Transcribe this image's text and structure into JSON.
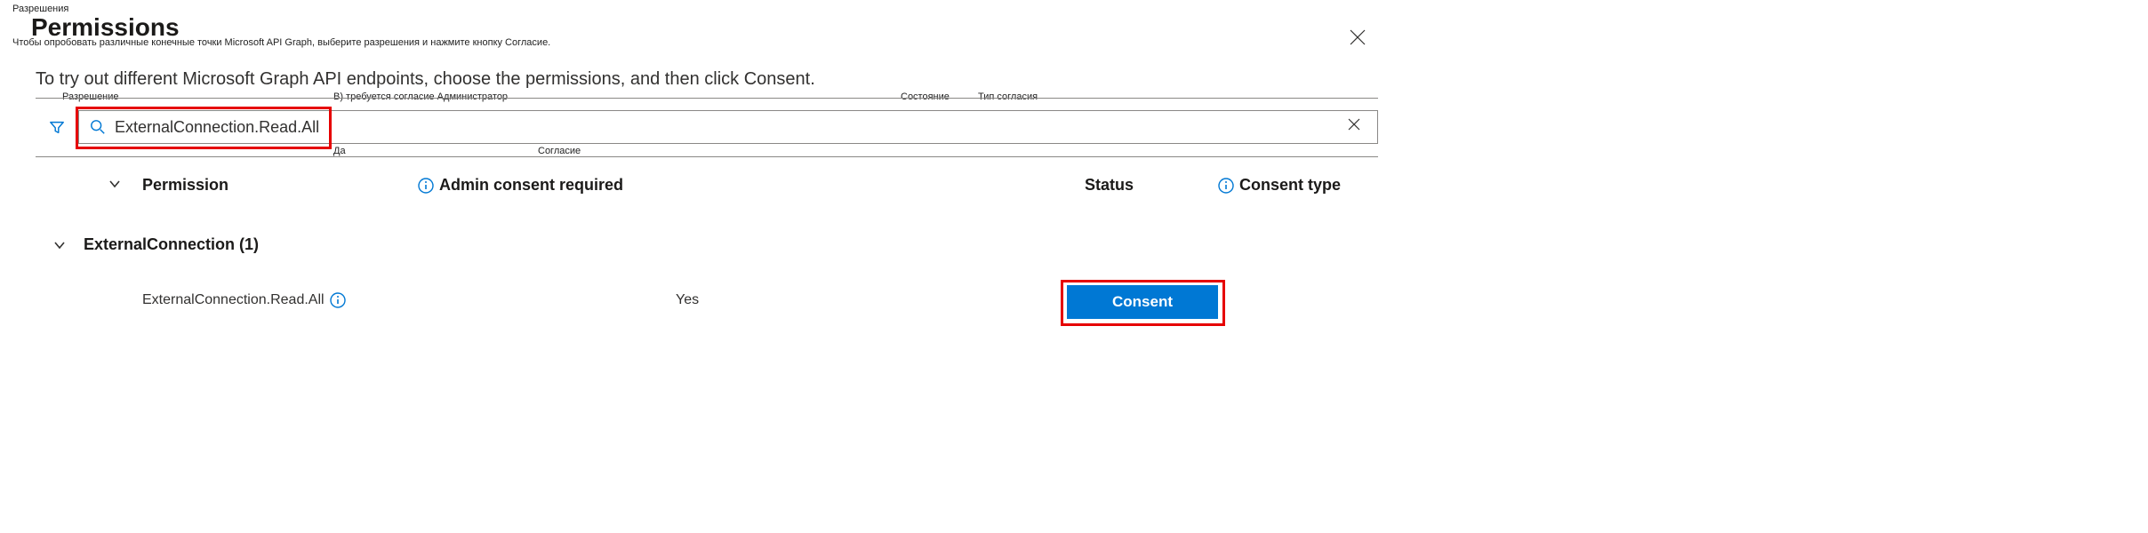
{
  "overlay": {
    "title_ru": "Разрешения",
    "subtitle_ru": "Чтобы опробовать различные конечные точки Microsoft API Graph, выберите разрешения и нажмите кнопку Согласие.",
    "col_permission_ru": "Разрешение",
    "col_admin_ru": "B) требуется согласие Администратор",
    "col_status_ru": "Состояние",
    "col_consent_type_ru": "Тип согласия",
    "yes_ru": "Да",
    "consent_ru": "Согласие"
  },
  "panel": {
    "title": "Permissions",
    "subtitle": "To try out different Microsoft Graph API endpoints, choose the permissions, and then click Consent."
  },
  "search": {
    "value": "ExternalConnection.Read.All"
  },
  "columns": {
    "permission": "Permission",
    "admin": "Admin consent required",
    "status": "Status",
    "consentType": "Consent type"
  },
  "group": {
    "label": "ExternalConnection (1)"
  },
  "row": {
    "name": "ExternalConnection.Read.All",
    "admin": "Yes",
    "consentButton": "Consent"
  },
  "colors": {
    "accent": "#0078d4",
    "highlight": "#e60000"
  }
}
